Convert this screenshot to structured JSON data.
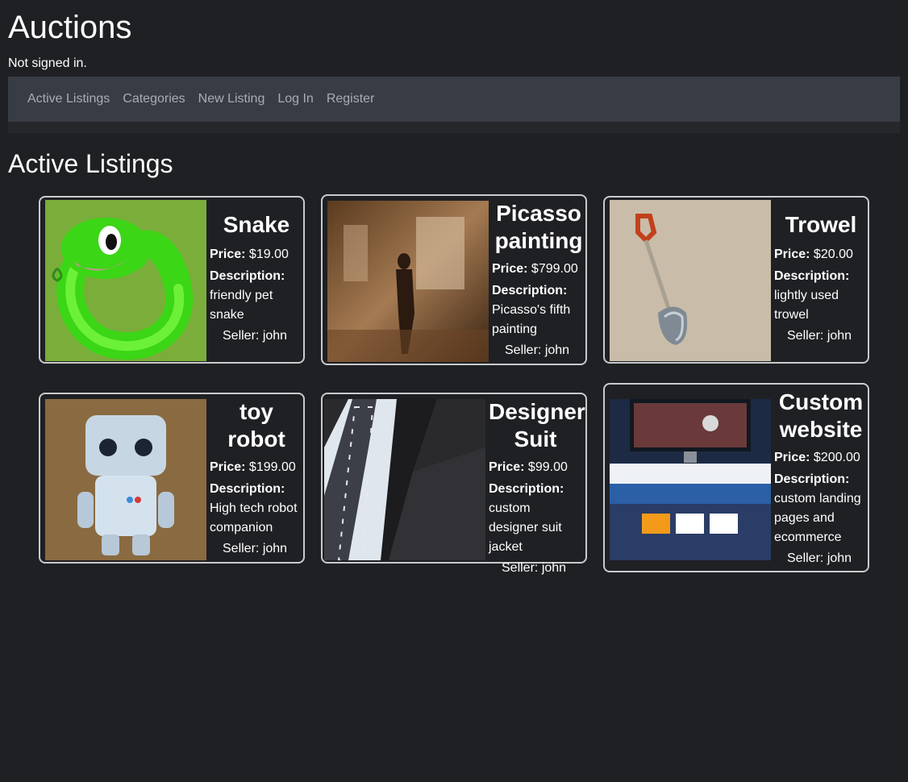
{
  "header": {
    "title": "Auctions",
    "signin_status": "Not signed in."
  },
  "nav": {
    "items": [
      "Active Listings",
      "Categories",
      "New Listing",
      "Log In",
      "Register"
    ]
  },
  "section_title": "Active Listings",
  "labels": {
    "price": "Price:",
    "description": "Description:",
    "seller_prefix": "Seller:"
  },
  "listings": [
    {
      "title": "Snake",
      "price": "$19.00",
      "description": "friendly pet snake",
      "seller": "john",
      "image": "green-snake-image"
    },
    {
      "title": "Picasso painting",
      "price": "$799.00",
      "description": "Picasso's fifth painting",
      "seller": "john",
      "image": "painting-image"
    },
    {
      "title": "Trowel",
      "price": "$20.00",
      "description": "lightly used trowel",
      "seller": "john",
      "image": "trowel-image"
    },
    {
      "title": "toy robot",
      "price": "$199.00",
      "description": "High tech robot companion",
      "seller": "john",
      "image": "robot-image"
    },
    {
      "title": "Designer Suit",
      "price": "$99.00",
      "description": "custom designer suit jacket",
      "seller": "john",
      "image": "suit-image"
    },
    {
      "title": "Custom website",
      "price": "$200.00",
      "description": "custom landing pages and ecommerce",
      "seller": "john",
      "image": "website-image"
    }
  ]
}
